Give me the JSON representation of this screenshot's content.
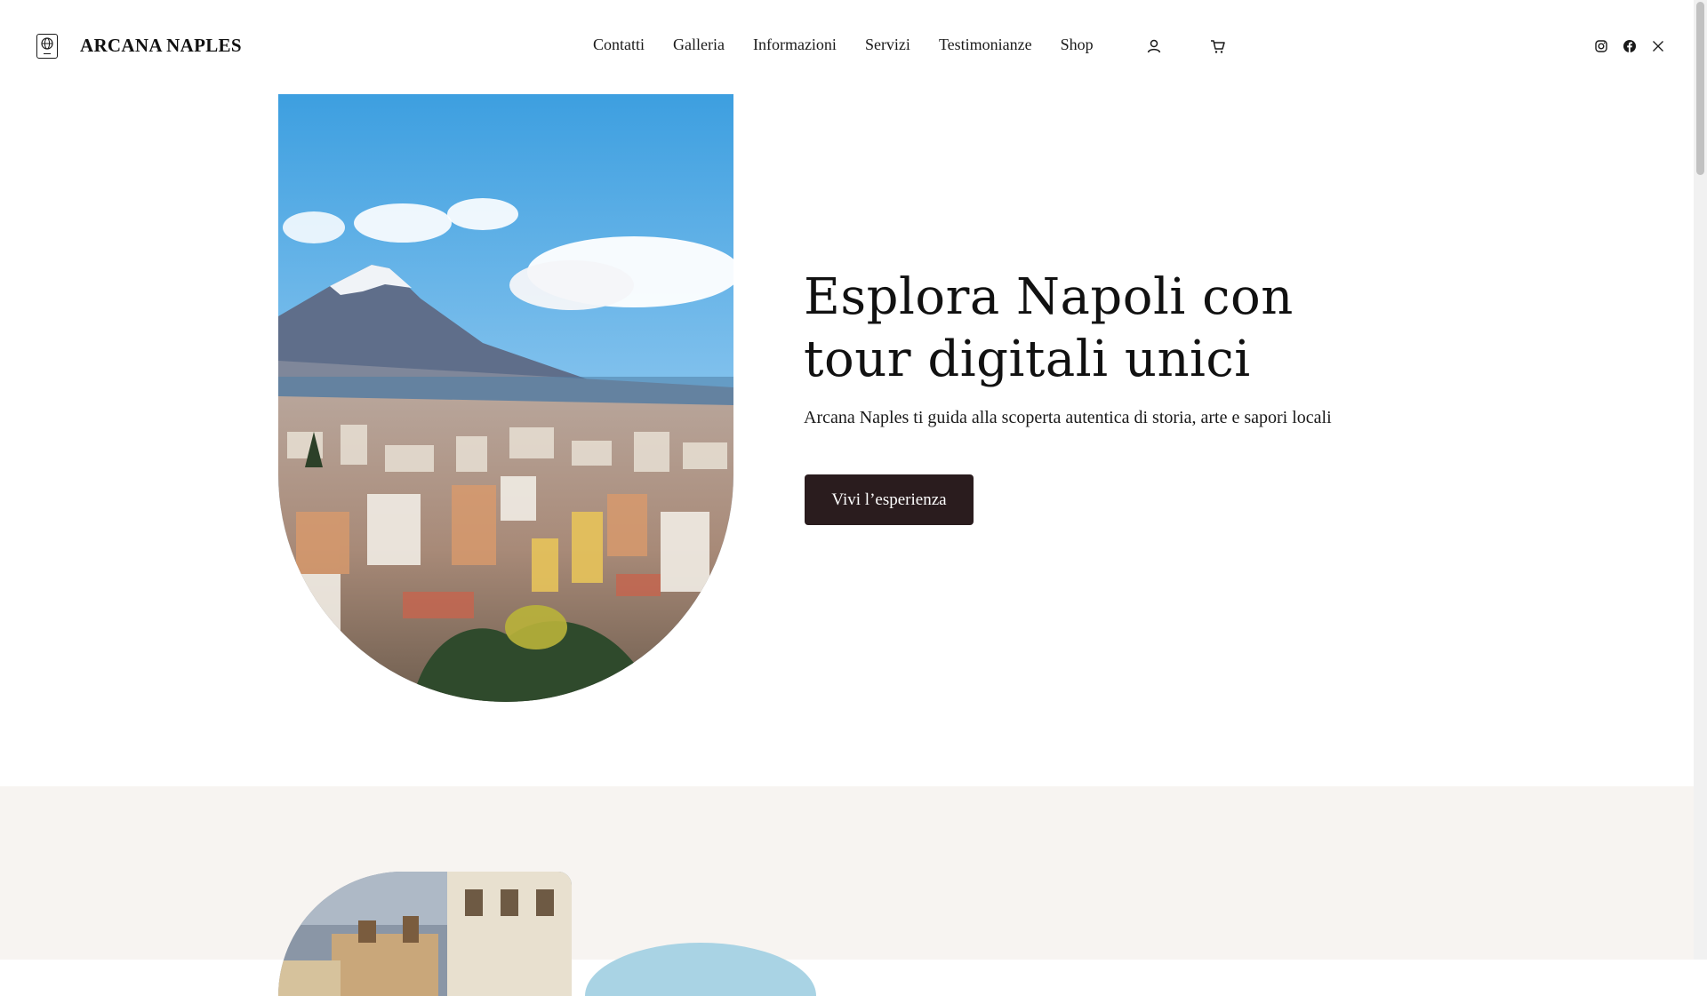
{
  "brand": {
    "name": "ARCANA NAPLES",
    "logo_icon": "globe-passport-icon"
  },
  "nav": {
    "items": [
      {
        "label": "Contatti"
      },
      {
        "label": "Galleria"
      },
      {
        "label": "Informazioni"
      },
      {
        "label": "Servizi"
      },
      {
        "label": "Testimonianze"
      },
      {
        "label": "Shop"
      }
    ],
    "account_icon": "user-icon",
    "cart_icon": "cart-icon"
  },
  "social": [
    "instagram-icon",
    "facebook-icon",
    "x-icon"
  ],
  "hero": {
    "title_line1": "Esplora Napoli con",
    "title_line2": "tour digitali unici",
    "subtitle": "Arcana Naples ti guida alla scoperta autentica di storia, arte e sapori locali",
    "cta_label": "Vivi l’esperienza",
    "image": "naples-vesuvius-cityscape"
  },
  "colors": {
    "cta_bg": "#2a1c1e",
    "section_bg": "#f7f4f1",
    "accent_blue": "#a9d3e4"
  }
}
